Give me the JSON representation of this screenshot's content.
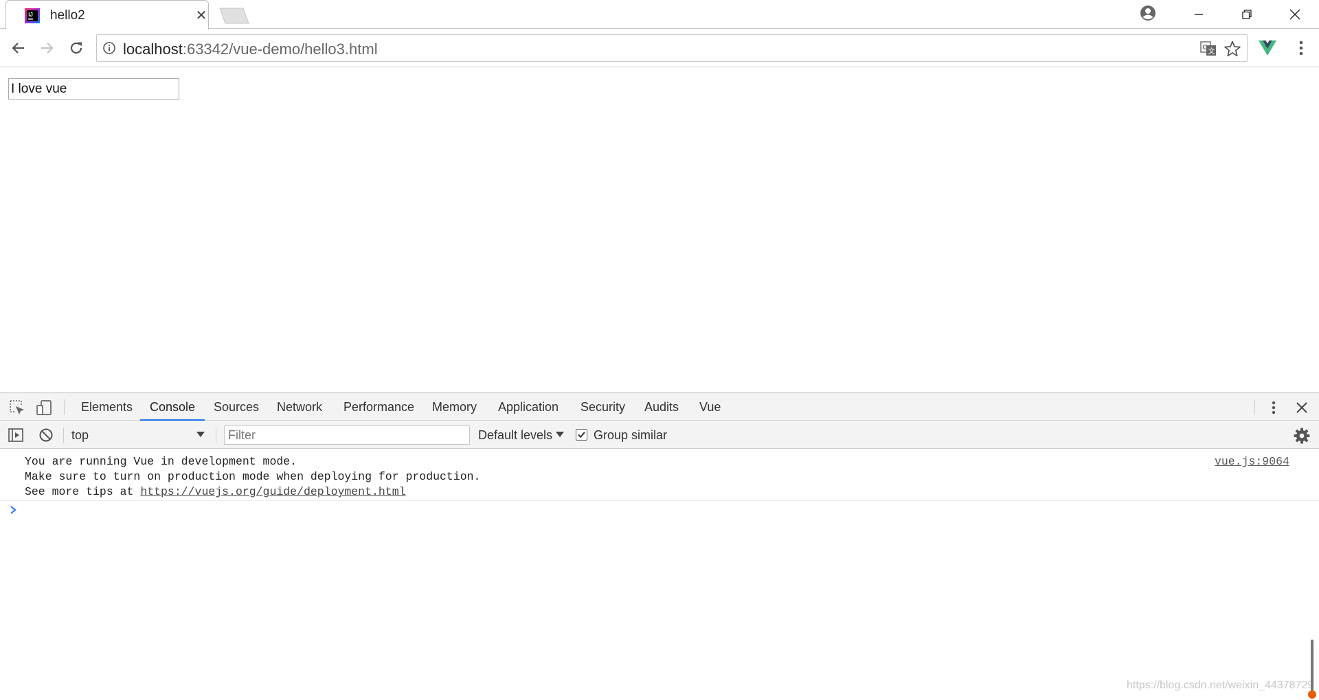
{
  "browser": {
    "tab": {
      "title": "hello2",
      "close_glyph": "✕",
      "favicon": "intellij-icon"
    },
    "address": {
      "host": "localhost",
      "rest": ":63342/vue-demo/hello3.html"
    },
    "icons": {
      "back": "arrow-left-icon",
      "forward": "arrow-right-icon",
      "reload": "reload-icon",
      "info": "info-icon",
      "translate": "translate-icon",
      "star": "star-icon",
      "vue_extension": "vue-logo-icon",
      "menu": "more-vert-icon",
      "profile": "profile-icon"
    }
  },
  "page": {
    "input_value": "I love vue"
  },
  "devtools": {
    "tabs": [
      "Elements",
      "Console",
      "Sources",
      "Network",
      "Performance",
      "Memory",
      "Application",
      "Security",
      "Audits",
      "Vue"
    ],
    "active_tab": "Console",
    "context": "top",
    "filter_placeholder": "Filter",
    "levels": "Default levels",
    "group_similar_label": "Group similar",
    "group_similar_checked": true,
    "message": {
      "line1": "You are running Vue in development mode.",
      "line2": "Make sure to turn on production mode when deploying for production.",
      "line3_prefix": "See more tips at ",
      "line3_link": "https://vuejs.org/guide/deployment.html",
      "source": "vue.js:9064"
    }
  },
  "watermark": "https://blog.csdn.net/weixin_44378729",
  "colors": {
    "accent": "#1a73e8",
    "vue_green": "#41b883",
    "vue_dark": "#34495e"
  }
}
